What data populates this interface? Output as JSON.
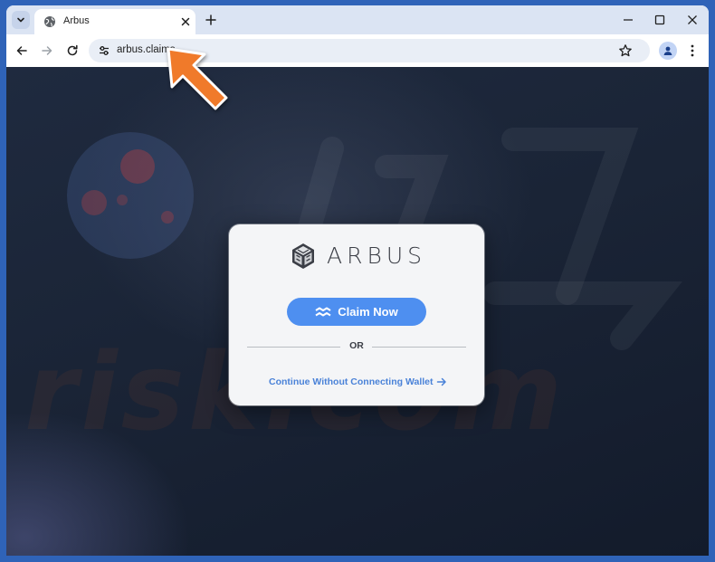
{
  "browser": {
    "tab": {
      "title": "Arbus"
    },
    "address_bar": {
      "url": "arbus.claims"
    }
  },
  "page": {
    "logo_text": "ARBUS",
    "claim_button_label": "Claim Now",
    "divider_label": "OR",
    "continue_link_label": "Continue Without Connecting Wallet",
    "watermark_text": "risk.com"
  },
  "icons": {
    "tab_menu": "chevron-down-icon",
    "favicon": "globe-icon",
    "tab_close": "close-icon",
    "new_tab": "plus-icon",
    "minimize": "minimize-icon",
    "maximize": "maximize-icon",
    "close_window": "close-icon",
    "back": "arrow-left-icon",
    "forward": "arrow-right-icon",
    "reload": "reload-icon",
    "site_info": "tune-icon",
    "bookmark": "star-icon",
    "profile": "person-icon",
    "menu": "kebab-icon",
    "claim": "waves-icon",
    "continue": "arrow-right-icon"
  },
  "colors": {
    "chrome_frame": "#dbe4f3",
    "accent_button": "#4e8ff0",
    "link": "#4a82d8",
    "page_bg": "#1a2436",
    "annotation_arrow": "#f07a2a"
  }
}
